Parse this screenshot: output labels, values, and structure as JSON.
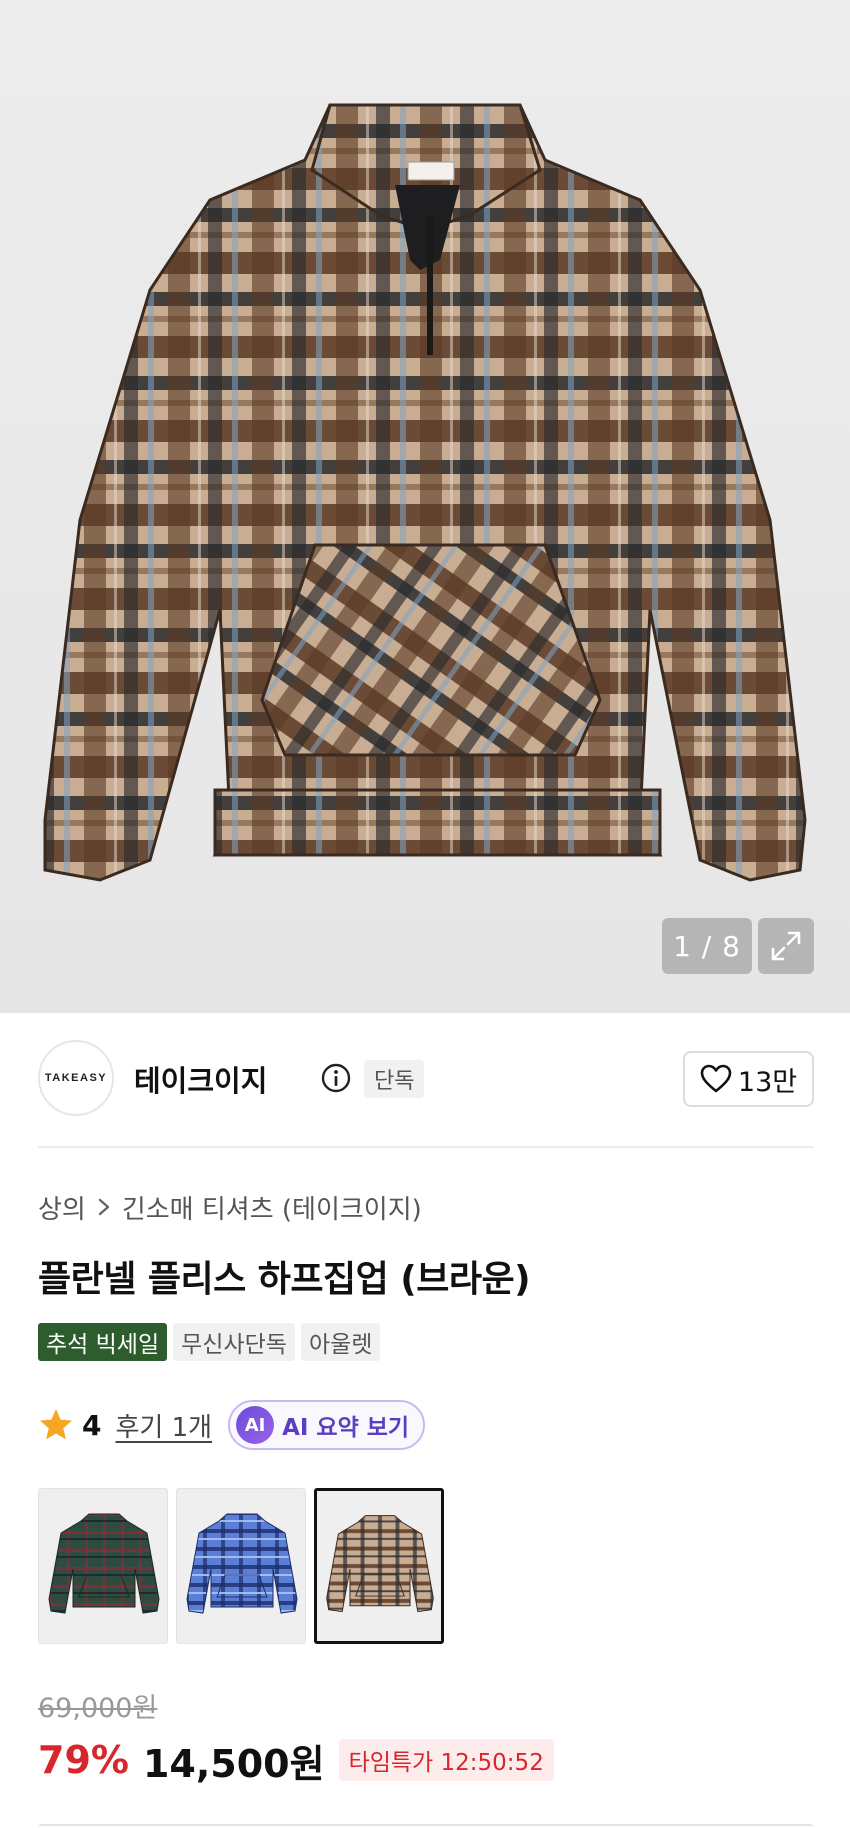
{
  "gallery": {
    "counter_current": "1",
    "counter_total": "8",
    "counter_text": "1 / 8",
    "expand_icon": "expand-icon"
  },
  "brand": {
    "logo_text": "TAKEASY",
    "name": "테이크이지",
    "info_icon": "info-icon",
    "exclusive_label": "단독",
    "like_icon": "heart-icon",
    "like_count": "13만"
  },
  "breadcrumb": {
    "items": [
      "상의",
      "긴소매 티셔츠 (테이크이지)"
    ],
    "separator_icon": "chevron-right-icon"
  },
  "product": {
    "title": "플란넬 플리스 하프집업 (브라운)",
    "badges": [
      "추석 빅세일",
      "무신사단독",
      "아울렛"
    ]
  },
  "rating": {
    "icon": "star-icon",
    "value": "4",
    "review_link": "후기 1개",
    "ai_badge": "AI",
    "ai_label": "AI 요약 보기"
  },
  "colors": {
    "options": [
      "green",
      "blue",
      "brown"
    ],
    "selected": "brown"
  },
  "price": {
    "original": "69,000원",
    "discount": "79%",
    "sale": "14,500원",
    "timer": "타임특가 12:50:52"
  },
  "theme": {
    "accent_red": "#d8262d",
    "sale_badge_green": "#2d5c2d",
    "ai_purple": "#6a4bd9"
  }
}
